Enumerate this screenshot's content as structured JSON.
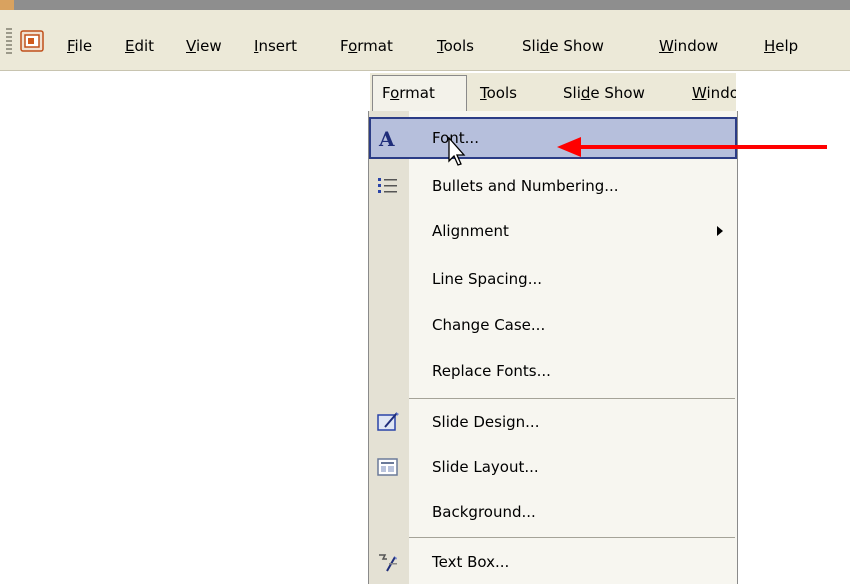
{
  "menubar": {
    "items": [
      {
        "label": "File",
        "key": "F"
      },
      {
        "label": "Edit",
        "key": "E"
      },
      {
        "label": "View",
        "key": "V"
      },
      {
        "label": "Insert",
        "key": "I"
      },
      {
        "label": "Format",
        "key": "o"
      },
      {
        "label": "Tools",
        "key": "T"
      },
      {
        "label": "Slide Show",
        "key": "d"
      },
      {
        "label": "Window",
        "key": "W"
      },
      {
        "label": "Help",
        "key": "H"
      }
    ]
  },
  "menu_header": {
    "items": [
      "Format",
      "Tools",
      "Slide Show",
      "Window"
    ]
  },
  "format_menu": {
    "items": [
      {
        "label": "Font...",
        "highlighted": true,
        "icon": "font-icon"
      },
      {
        "label": "Bullets and Numbering...",
        "icon": "bullets-icon"
      },
      {
        "label": "Alignment",
        "has_submenu": true
      },
      {
        "label": "Line Spacing..."
      },
      {
        "label": "Change Case..."
      },
      {
        "label": "Replace Fonts..."
      },
      {
        "label": "Slide Design...",
        "icon": "slide-design-icon"
      },
      {
        "label": "Slide Layout...",
        "icon": "slide-layout-icon"
      },
      {
        "label": "Background..."
      },
      {
        "label": "Text Box...",
        "icon": "text-box-icon"
      }
    ]
  },
  "colors": {
    "highlight_fill": "#b6bfdc",
    "highlight_border": "#2b3c86",
    "annotation_arrow": "#ff0000",
    "menubar_bg": "#ece9d8"
  }
}
